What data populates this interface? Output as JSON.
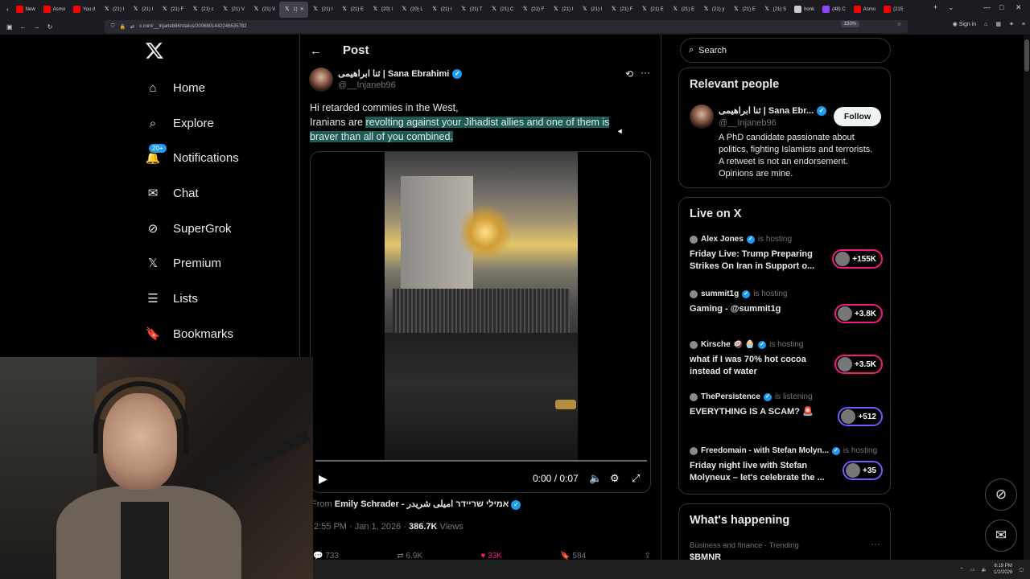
{
  "browser": {
    "tabs": [
      {
        "label": "New",
        "icon": "youtube-icon",
        "color": "#ff0000"
      },
      {
        "label": "Asmo",
        "icon": "youtube-icon",
        "color": "#ff0000"
      },
      {
        "label": "You d",
        "icon": "youtube-icon",
        "color": "#ff0000"
      },
      {
        "label": "(21) I",
        "icon": "x-icon",
        "color": "#ffffff"
      },
      {
        "label": "(21) I",
        "icon": "x-icon",
        "color": "#ffffff"
      },
      {
        "label": "(21) F",
        "icon": "x-icon",
        "color": "#ffffff"
      },
      {
        "label": "(21) c",
        "icon": "x-icon",
        "color": "#ffffff"
      },
      {
        "label": "(21) V",
        "icon": "x-icon",
        "color": "#ffffff"
      },
      {
        "label": "(21) V",
        "icon": "x-icon",
        "color": "#ffffff"
      },
      {
        "label": "1)",
        "icon": "x-icon",
        "color": "#ffffff",
        "active": true
      },
      {
        "label": "(21) I",
        "icon": "x-icon",
        "color": "#ffffff"
      },
      {
        "label": "(21) E",
        "icon": "x-icon",
        "color": "#ffffff"
      },
      {
        "label": "(20) I",
        "icon": "x-icon",
        "color": "#ffffff"
      },
      {
        "label": "(20) L",
        "icon": "x-icon",
        "color": "#ffffff"
      },
      {
        "label": "(21) I",
        "icon": "x-icon",
        "color": "#ffffff"
      },
      {
        "label": "(21) T",
        "icon": "x-icon",
        "color": "#ffffff"
      },
      {
        "label": "(21) C",
        "icon": "x-icon",
        "color": "#ffffff"
      },
      {
        "label": "(21) F",
        "icon": "x-icon",
        "color": "#ffffff"
      },
      {
        "label": "(21) I",
        "icon": "x-icon",
        "color": "#ffffff"
      },
      {
        "label": "(21) I",
        "icon": "x-icon",
        "color": "#ffffff"
      },
      {
        "label": "(21) F",
        "icon": "x-icon",
        "color": "#ffffff"
      },
      {
        "label": "(21) E",
        "icon": "x-icon",
        "color": "#ffffff"
      },
      {
        "label": "(21) E",
        "icon": "x-icon",
        "color": "#ffffff"
      },
      {
        "label": "(21) y",
        "icon": "x-icon",
        "color": "#ffffff"
      },
      {
        "label": "(21) E",
        "icon": "x-icon",
        "color": "#ffffff"
      },
      {
        "label": "(21) S",
        "icon": "x-icon",
        "color": "#ffffff"
      },
      {
        "label": "honk",
        "icon": "globe-icon",
        "color": "#cccccc"
      },
      {
        "label": "(48) C",
        "icon": "twitch-icon",
        "color": "#9146ff"
      },
      {
        "label": "Asmo",
        "icon": "youtube-icon",
        "color": "#ff0000"
      },
      {
        "label": "(215",
        "icon": "youtube-icon",
        "color": "#ff0000"
      }
    ],
    "url": "x.com/__Injaneb96/status/2006801442246635782",
    "zoom": "150%",
    "signin": "Sign in"
  },
  "left_nav": {
    "items": [
      {
        "label": "Home",
        "icon": "home-icon"
      },
      {
        "label": "Explore",
        "icon": "search-icon"
      },
      {
        "label": "Notifications",
        "icon": "bell-icon",
        "badge": "20+"
      },
      {
        "label": "Chat",
        "icon": "mail-icon"
      },
      {
        "label": "SuperGrok",
        "icon": "grok-icon"
      },
      {
        "label": "Premium",
        "icon": "x-icon"
      },
      {
        "label": "Lists",
        "icon": "list-icon"
      },
      {
        "label": "Bookmarks",
        "icon": "bookmark-icon"
      }
    ]
  },
  "post": {
    "header_title": "Post",
    "author_name": "ثنا ابراهیمی | Sana Ebrahimi",
    "author_handle": "@__Injaneb96",
    "text_line1": "Hi retarded commies in the West,",
    "text_line2_plain": "Iranians are ",
    "text_line2_highlight": "revolting against your Jihadist allies and one of them is braver than all of you combined.",
    "video": {
      "time": "0:00 / 0:07",
      "progress": 0
    },
    "from_prefix": "From",
    "from_name": "Emily Schrader - אמילי שריידר امیلی شریدر",
    "time": "2:55 PM · Jan 1, 2026 · ",
    "views_count": "386.7K",
    "views_label": " Views",
    "actions": {
      "replies": "733",
      "reposts": "6.9K",
      "likes": "33K",
      "bookmarks": "584"
    }
  },
  "right": {
    "search_placeholder": "Search",
    "relevant_people": {
      "title": "Relevant people",
      "name": "ثنا ابراهیمی | Sana Ebr...",
      "handle": "@__Injaneb96",
      "follow": "Follow",
      "bio": "A PhD candidate passionate about politics, fighting Islamists and terrorists. A retweet is not an endorsement. Opinions are mine."
    },
    "live": {
      "title": "Live on X",
      "items": [
        {
          "host": "Alex Jones",
          "status": "is hosting",
          "title": "Friday Live: Trump Preparing Strikes On Iran in Support o...",
          "count": "+155K"
        },
        {
          "host": "summit1g",
          "status": "is hosting",
          "title": "Gaming - @summit1g",
          "count": "+3.8K"
        },
        {
          "host": "Kirsche 🥥 🧁",
          "status": "is hosting",
          "title": "what if I was 70% hot cocoa instead of water",
          "count": "+3.5K"
        },
        {
          "host": "ThePersistence",
          "status": "is listening",
          "title": "EVERYTHING IS A SCAM? 🚨",
          "count": "+512"
        },
        {
          "host": "Freedomain - with Stefan Molyn...",
          "status": "is hosting",
          "title": "Friday night live with Stefan Molyneux – let's celebrate the ...",
          "count": "+35"
        }
      ]
    },
    "happening": {
      "title": "What's happening",
      "category": "Business and finance · Trending",
      "trend": "$BMNR"
    }
  },
  "taskbar": {
    "time": "6:19 PM",
    "date": "1/2/2026"
  },
  "colors": {
    "accent": "#1d9bf0",
    "like": "#f91880",
    "highlight": "#1c5c54"
  }
}
